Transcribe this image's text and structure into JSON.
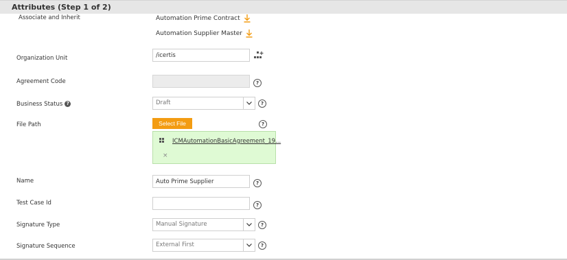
{
  "header": {
    "title": "Attributes (Step 1 of 2)"
  },
  "associate": {
    "label": "Associate and Inherit",
    "links": [
      {
        "label": "Automation Prime Contract",
        "icon": "download-icon"
      },
      {
        "label": "Automation Supplier Master",
        "icon": "download-icon"
      }
    ]
  },
  "fields": {
    "org_unit": {
      "label": "Organization Unit",
      "value": "/icertis"
    },
    "agreement_code": {
      "label": "Agreement Code",
      "value": ""
    },
    "business_status": {
      "label": "Business Status",
      "value": "Draft"
    },
    "file_path": {
      "label": "File Path",
      "button": "Select File",
      "file_name": "ICMAutomationBasicAgreement_19...",
      "remove": "×"
    },
    "name": {
      "label": "Name",
      "value": "Auto Prime Supplier"
    },
    "test_case_id": {
      "label": "Test Case Id",
      "value": ""
    },
    "signature_type": {
      "label": "Signature Type",
      "value": "Manual Signature"
    },
    "signature_sequence": {
      "label": "Signature Sequence",
      "value": "External First"
    }
  },
  "colors": {
    "accent": "#f39c12",
    "file_bg": "#dffad4",
    "header_bg": "#e6e6e6"
  }
}
